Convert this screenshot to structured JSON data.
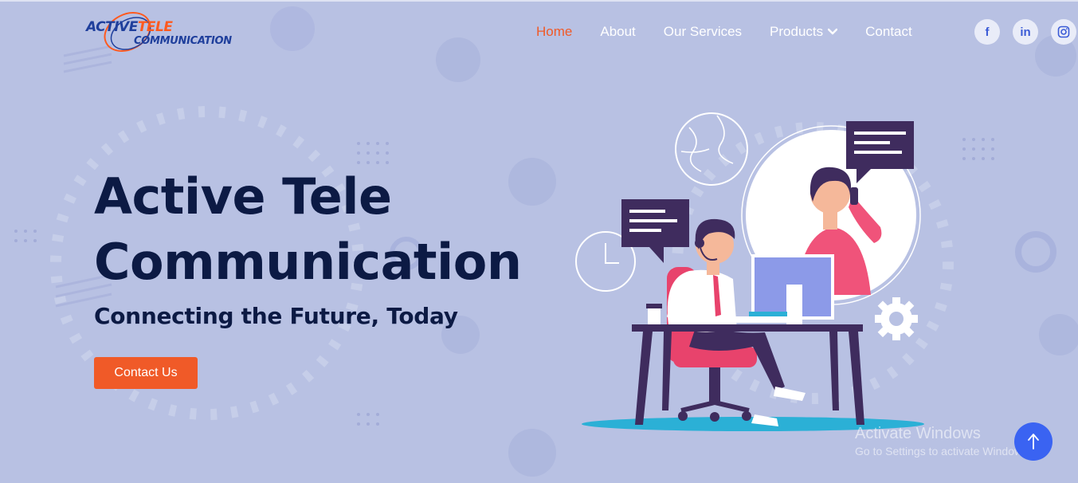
{
  "brand": {
    "line1_a": "ACTIVE",
    "line1_b": "TELE",
    "line2": "COMMUNICATION",
    "primary_color": "#1f3f9c",
    "accent_color": "#ff5a1f"
  },
  "nav": {
    "items": [
      {
        "label": "Home",
        "active": true
      },
      {
        "label": "About",
        "active": false
      },
      {
        "label": "Our Services",
        "active": false
      },
      {
        "label": "Products",
        "active": false,
        "dropdown": true
      },
      {
        "label": "Contact",
        "active": false
      }
    ],
    "active_color": "#f05a28"
  },
  "social": {
    "facebook": "f",
    "linkedin": "in",
    "instagram_icon": "instagram-icon"
  },
  "hero": {
    "title_line1": "Active Tele",
    "title_line2": "Communication",
    "subtitle": "Connecting the Future, Today",
    "cta_label": "Contact Us",
    "cta_color": "#f05a28"
  },
  "watermark": {
    "line1": "Activate Windows",
    "line2": "Go to Settings to activate Windows."
  },
  "scroll_top": {
    "icon": "arrow-up-icon",
    "color": "#3a63f2"
  }
}
